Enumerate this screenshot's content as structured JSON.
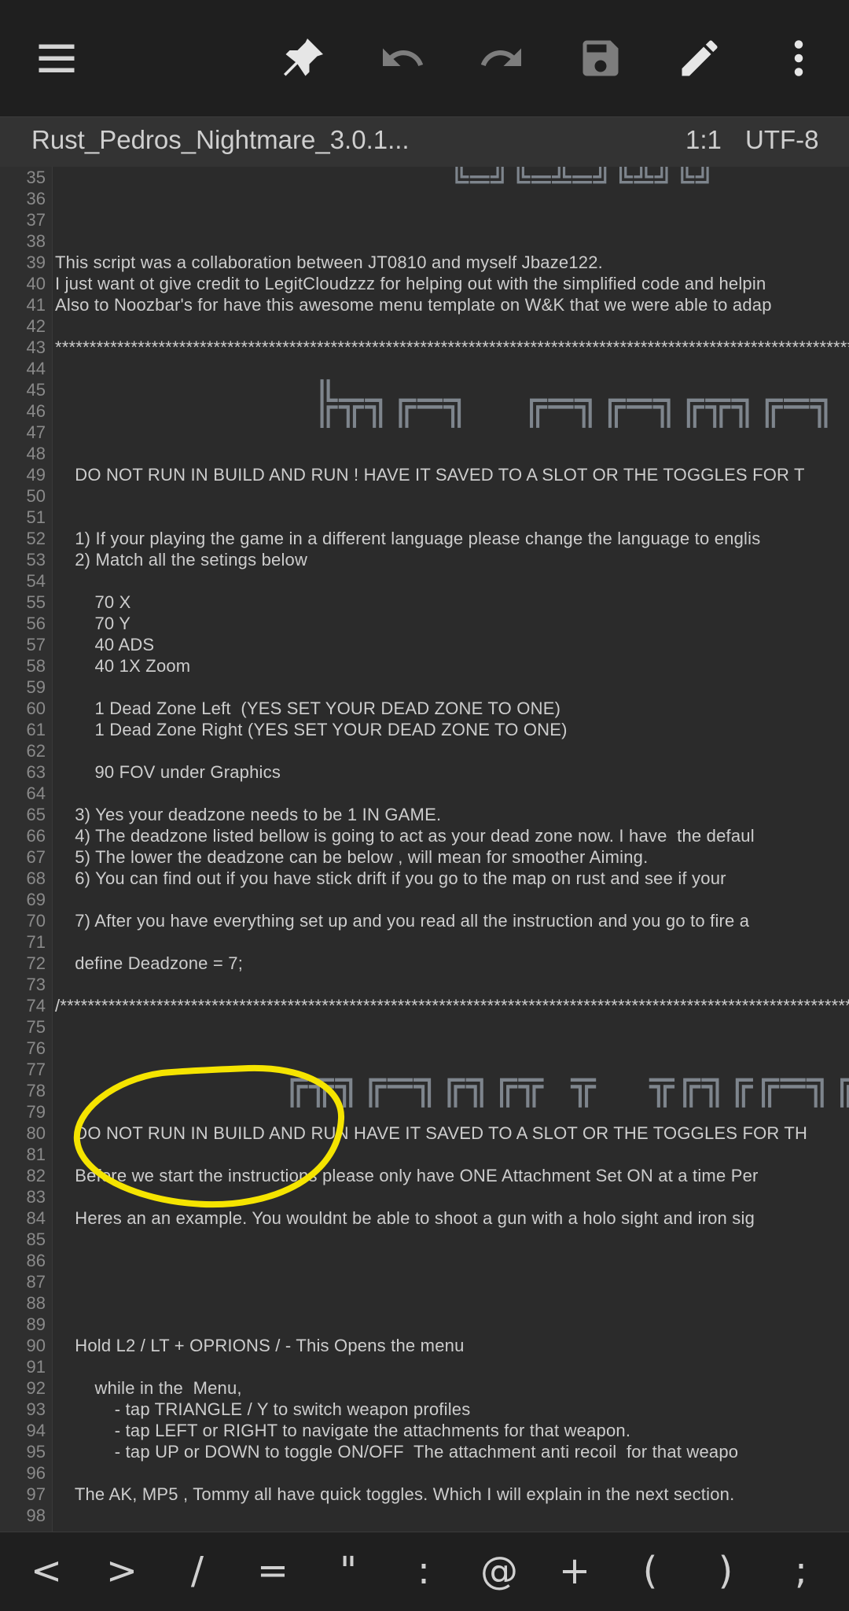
{
  "toolbar": {
    "icons": [
      "menu-icon",
      "pin-icon",
      "undo-icon",
      "redo-icon",
      "save-icon",
      "edit-icon",
      "more-icon"
    ]
  },
  "file": {
    "name": "Rust_Pedros_Nightmare_3.0.1...",
    "cursor": "1:1",
    "encoding": "UTF-8"
  },
  "editor": {
    "lines": [
      {
        "n": "35",
        "text": ""
      },
      {
        "n": "36",
        "text": ""
      },
      {
        "n": "37",
        "text": ""
      },
      {
        "n": "38",
        "text": ""
      },
      {
        "n": "39",
        "text": "This script was a collaboration between JT0810 and myself Jbaze122."
      },
      {
        "n": "40",
        "text": "I just want ot give credit to LegitCloudzzz for helping out with the simplified code and helpin"
      },
      {
        "n": "41",
        "text": "Also to Noozbar's for have this awesome menu template on W&K that we were able to adap"
      },
      {
        "n": "42",
        "text": ""
      },
      {
        "n": "43",
        "text": "**************************************************************************************************************************"
      },
      {
        "n": "44",
        "text": ""
      },
      {
        "n": "45",
        "text": ""
      },
      {
        "n": "46",
        "text": ""
      },
      {
        "n": "47",
        "text": ""
      },
      {
        "n": "48",
        "text": ""
      },
      {
        "n": "49",
        "text": "    DO NOT RUN IN BUILD AND RUN ! HAVE IT SAVED TO A SLOT OR THE TOGGLES FOR T"
      },
      {
        "n": "50",
        "text": ""
      },
      {
        "n": "51",
        "text": ""
      },
      {
        "n": "52",
        "text": "    1) If your playing the game in a different language please change the language to englis"
      },
      {
        "n": "53",
        "text": "    2) Match all the setings below"
      },
      {
        "n": "54",
        "text": ""
      },
      {
        "n": "55",
        "text": "        70 X"
      },
      {
        "n": "56",
        "text": "        70 Y"
      },
      {
        "n": "57",
        "text": "        40 ADS"
      },
      {
        "n": "58",
        "text": "        40 1X Zoom"
      },
      {
        "n": "59",
        "text": ""
      },
      {
        "n": "60",
        "text": "        1 Dead Zone Left  (YES SET YOUR DEAD ZONE TO ONE)"
      },
      {
        "n": "61",
        "text": "        1 Dead Zone Right (YES SET YOUR DEAD ZONE TO ONE)"
      },
      {
        "n": "62",
        "text": ""
      },
      {
        "n": "63",
        "text": "        90 FOV under Graphics"
      },
      {
        "n": "64",
        "text": ""
      },
      {
        "n": "65",
        "text": "    3) Yes your deadzone needs to be 1 IN GAME."
      },
      {
        "n": "66",
        "text": "    4) The deadzone listed bellow is going to act as your dead zone now. I have  the defaul"
      },
      {
        "n": "67",
        "text": "    5) The lower the deadzone can be below , will mean for smoother Aiming."
      },
      {
        "n": "68",
        "text": "    6) You can find out if you have stick drift if you go to the map on rust and see if your"
      },
      {
        "n": "69",
        "text": ""
      },
      {
        "n": "70",
        "text": "    7) After you have everything set up and you read all the instruction and you go to fire a"
      },
      {
        "n": "71",
        "text": ""
      },
      {
        "n": "72",
        "text": "    define Deadzone = 7;"
      },
      {
        "n": "73",
        "text": ""
      },
      {
        "n": "74",
        "text": "/****************************************************************************************************************************"
      },
      {
        "n": "75",
        "text": ""
      },
      {
        "n": "76",
        "text": ""
      },
      {
        "n": "77",
        "text": ""
      },
      {
        "n": "78",
        "text": ""
      },
      {
        "n": "79",
        "text": ""
      },
      {
        "n": "80",
        "text": "    DO NOT RUN IN BUILD AND RUN HAVE IT SAVED TO A SLOT OR THE TOGGLES FOR TH"
      },
      {
        "n": "81",
        "text": ""
      },
      {
        "n": "82",
        "text": "    Before we start the instructions please only have ONE Attachment Set ON at a time Per"
      },
      {
        "n": "83",
        "text": ""
      },
      {
        "n": "84",
        "text": "    Heres an an example. You wouldnt be able to shoot a gun with a holo sight and iron sig"
      },
      {
        "n": "85",
        "text": ""
      },
      {
        "n": "86",
        "text": ""
      },
      {
        "n": "87",
        "text": ""
      },
      {
        "n": "88",
        "text": ""
      },
      {
        "n": "89",
        "text": ""
      },
      {
        "n": "90",
        "text": "    Hold L2 / LT + OPRIONS / - This Opens the menu"
      },
      {
        "n": "91",
        "text": ""
      },
      {
        "n": "92",
        "text": "        while in the  Menu,"
      },
      {
        "n": "93",
        "text": "            - tap TRIANGLE / Y to switch weapon profiles"
      },
      {
        "n": "94",
        "text": "            - tap LEFT or RIGHT to navigate the attachments for that weapon."
      },
      {
        "n": "95",
        "text": "            - tap UP or DOWN to toggle ON/OFF  The attachment anti recoil  for that weapo"
      },
      {
        "n": "96",
        "text": ""
      },
      {
        "n": "97",
        "text": "    The AK, MP5 , Tommy all have quick toggles. Which I will explain in the next section."
      },
      {
        "n": "98",
        "text": ""
      }
    ],
    "banners": {
      "top": "╚═╝╚═╩═╝╚╩╝╚╝",
      "in_game_settings": "╠╦╗╔═╗  ╔═╗╔═╗╔╦╗╔═╗  ╔═╗╔═╗╔╦╗╔╦╗",
      "menu_instructions": "╔╦╗╔═╗╔╗╔╦ ╦  ╦╔╗╔╔═╗╔╦╗╦═╗╦ ╦╔═╗╔╦╗"
    }
  },
  "keybar": {
    "keys": [
      "<",
      ">",
      "/",
      "=",
      "\"",
      ":",
      "@",
      "+",
      "(",
      ")",
      ";"
    ]
  }
}
